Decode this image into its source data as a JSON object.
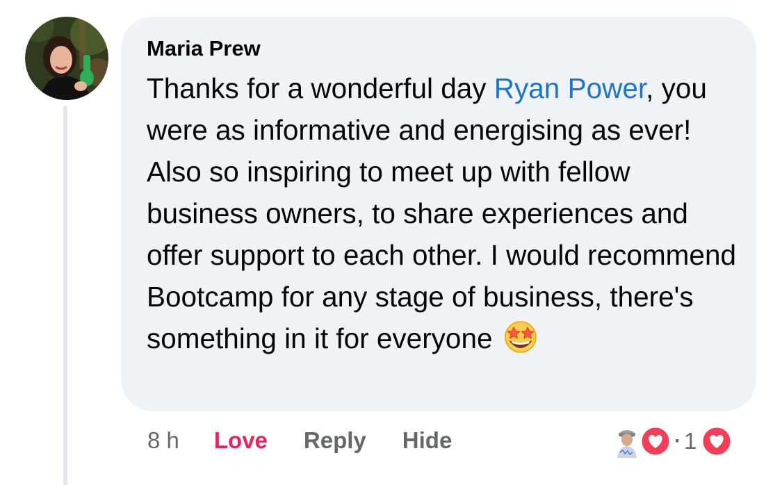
{
  "comment": {
    "author": "Maria Prew",
    "text_before_mention": "Thanks for a wonderful day ",
    "mention": "Ryan Power",
    "text_after_mention": ", you were as informative and energising as ever! Also so inspiring to meet up with fellow business owners, to share experiences and offer support to each other. I would recommend Bootcamp for any stage of business, there's something in it for everyone",
    "trailing_emoji": "star-struck-emoji"
  },
  "actions": {
    "timestamp": "8 h",
    "love_label": "Love",
    "reply_label": "Reply",
    "hide_label": "Hide"
  },
  "reactions": {
    "separator": "·",
    "count": "1",
    "type": "love-heart-icon"
  },
  "colors": {
    "bubble_bg": "#f0f2f5",
    "mention": "#1876d2",
    "love": "#e8245a",
    "meta_text": "#65676b",
    "body_text": "#050505"
  }
}
